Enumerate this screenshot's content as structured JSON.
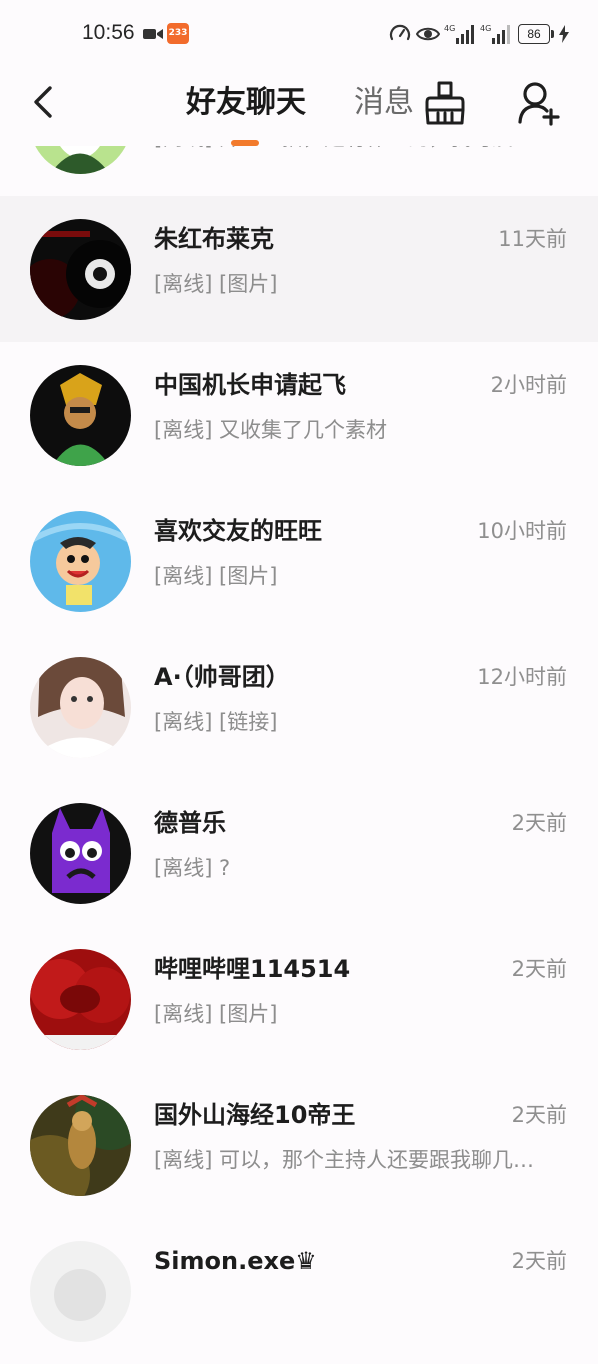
{
  "status_bar": {
    "time": "10:56",
    "app_badge": "233",
    "net_4g_1": "4G",
    "net_4g_2": "4G",
    "battery": "86"
  },
  "header": {
    "tab_friends": "好友聊天",
    "tab_messages": "消息",
    "back_icon": "chevron-left-icon",
    "clean_icon": "broom-icon",
    "add_icon": "add-user-icon",
    "accent_color": "#f27a2c"
  },
  "chats": [
    {
      "name": "",
      "time": "",
      "preview": "[离线] 开直主播，是有作业的，我可及…"
    },
    {
      "name": "朱红布莱克",
      "time": "11天前",
      "preview": "[离线] [图片]"
    },
    {
      "name": "中国机长申请起飞",
      "time": "2小时前",
      "preview": "[离线] 又收集了几个素材"
    },
    {
      "name": "喜欢交友的旺旺",
      "time": "10小时前",
      "preview": "[离线] [图片]"
    },
    {
      "name": "A·（帅哥团）",
      "time": "12小时前",
      "preview": "[离线] [链接]"
    },
    {
      "name": "德普乐",
      "time": "2天前",
      "preview": "[离线] ?"
    },
    {
      "name": "哔哩哔哩114514",
      "time": "2天前",
      "preview": "[离线] [图片]"
    },
    {
      "name": "国外山海经10帝王",
      "time": "2天前",
      "preview": "[离线] 可以，那个主持人还要跟我聊几…"
    },
    {
      "name": "Simon.exe♛",
      "time": "2天前",
      "preview": ""
    }
  ]
}
